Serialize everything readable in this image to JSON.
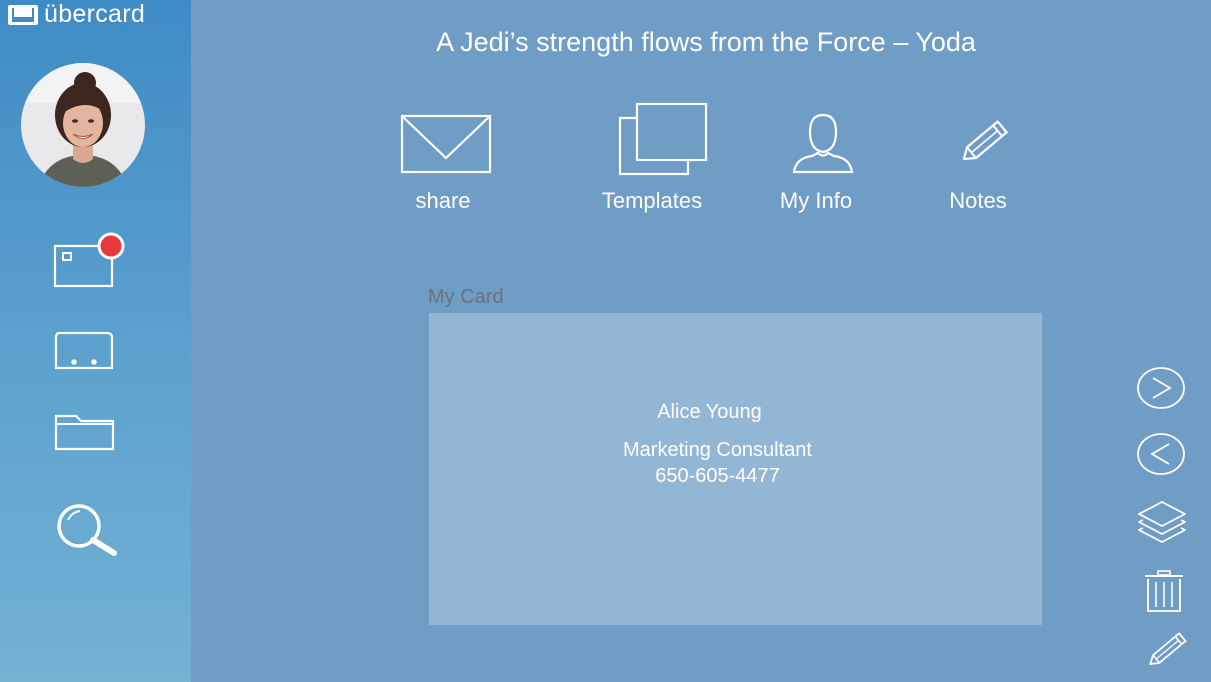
{
  "app": {
    "name": "übercard"
  },
  "quote": "A Jedi’s strength flows from the Force – Yoda",
  "toolbar": {
    "share_label": "share",
    "templates_label": "Templates",
    "myinfo_label": "My Info",
    "notes_label": "Notes"
  },
  "card": {
    "caption": "My Card",
    "name": "Alice Young",
    "title": "Marketing Consultant",
    "phone": "650-605-4477"
  },
  "sidebar": {
    "items": [
      {
        "icon": "inbox-card-icon",
        "has_notification": true
      },
      {
        "icon": "card-holder-icon"
      },
      {
        "icon": "folder-icon"
      },
      {
        "icon": "search-icon"
      }
    ]
  },
  "right_actions": [
    {
      "icon": "next-icon"
    },
    {
      "icon": "previous-icon"
    },
    {
      "icon": "layers-icon"
    },
    {
      "icon": "trash-icon"
    },
    {
      "icon": "edit-pencil-icon"
    }
  ],
  "colors": {
    "background": "#6f9dc6",
    "sidebar_top": "#3f8bc5",
    "card": "#93b6d4",
    "notification": "#e8383d"
  }
}
